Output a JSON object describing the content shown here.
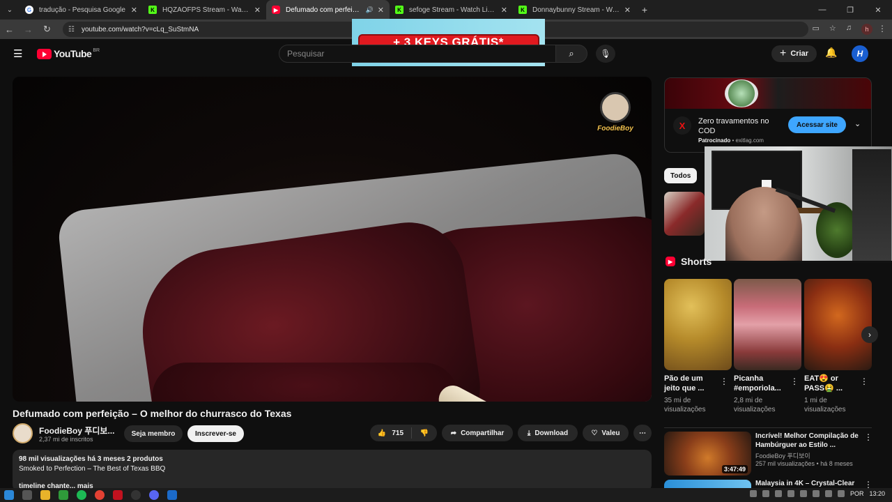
{
  "browser": {
    "tabs": [
      {
        "title": "tradução - Pesquisa Google",
        "favicon": "google-icon",
        "color": "#ffffff",
        "active": false
      },
      {
        "title": "HQZAOFPS Stream - Watch Live",
        "favicon": "kick-icon",
        "color": "#53fc18",
        "active": false
      },
      {
        "title": "Defumado com perfeição –",
        "favicon": "youtube-icon",
        "color": "#ff0033",
        "active": true
      },
      {
        "title": "sefoge Stream - Watch Live on",
        "favicon": "kick-icon",
        "color": "#53fc18",
        "active": false
      },
      {
        "title": "Donnaybunny Stream - Watch",
        "favicon": "kick-icon",
        "color": "#53fc18",
        "active": false
      }
    ],
    "url": "youtube.com/watch?v=cLq_SuStmNA",
    "profile_initial": "h"
  },
  "overlay_ad": {
    "text": "+ 3 KEYS GRÁTIS*"
  },
  "header": {
    "logo_text": "YouTube",
    "region": "BR",
    "search_placeholder": "Pesquisar",
    "create_label": "Criar",
    "account_initial": "H"
  },
  "video": {
    "watermark": "FoodieBoy",
    "title": "Defumado com perfeição – O melhor do churrasco do Texas",
    "channel_name": "FoodieBoy 푸디보...",
    "subscribers": "2,37 mi de inscritos",
    "member_label": "Seja membro",
    "subscribe_label": "Inscrever-se",
    "likes": "715",
    "share_label": "Compartilhar",
    "download_label": "Download",
    "thanks_label": "Valeu",
    "description": {
      "meta": "98 mil visualizações  há 3 meses  2 produtos",
      "line": "Smoked to Perfection – The Best of Texas BBQ",
      "extra": "timeline chante...  mais"
    }
  },
  "sidebar_ad": {
    "title": "Zero travamentos no COD",
    "sponsored": "Patrocinado",
    "domain": "exitlag.com",
    "cta": "Acessar site"
  },
  "chips": {
    "first": "Todos"
  },
  "shorts": {
    "heading": "Shorts",
    "items": [
      {
        "title": "Pão de um jeito que ...",
        "views": "35 mi de visualizações"
      },
      {
        "title": "Picanha #emporiola...",
        "views": "2,8 mi de visualizações"
      },
      {
        "title": "EAT😍 or PASS🤮 ...",
        "views": "1 mi de visualizações"
      }
    ]
  },
  "recommendations": [
    {
      "title": "Incrível! Melhor Compilação de Hambúrguer ao Estilo ...",
      "channel": "FoodieBoy 푸디보이",
      "views": "257 mil visualizações • há 8 meses",
      "duration": "3:47:49"
    },
    {
      "title": "Malaysia in 4K – Crystal-Clear"
    }
  ],
  "taskbar": {
    "lang": "POR",
    "time": "13:20"
  }
}
